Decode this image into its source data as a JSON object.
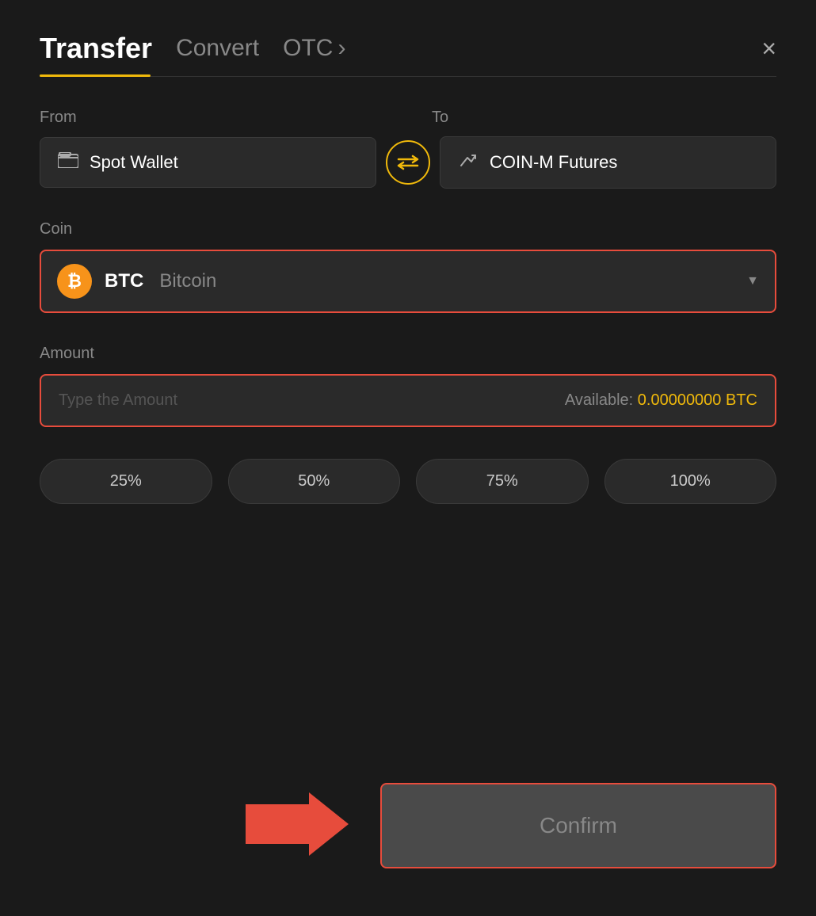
{
  "header": {
    "tab_transfer": "Transfer",
    "tab_convert": "Convert",
    "tab_otc": "OTC",
    "otc_chevron": "›",
    "close_label": "×"
  },
  "from": {
    "label": "From",
    "wallet_name": "Spot Wallet"
  },
  "to": {
    "label": "To",
    "wallet_name": "COIN-M Futures"
  },
  "coin": {
    "label": "Coin",
    "symbol": "BTC",
    "name": "Bitcoin"
  },
  "amount": {
    "label": "Amount",
    "placeholder": "Type the Amount",
    "available_label": "Available:",
    "available_value": "0.00000000 BTC"
  },
  "percent_buttons": [
    "25%",
    "50%",
    "75%",
    "100%"
  ],
  "confirm": {
    "label": "Confirm"
  }
}
